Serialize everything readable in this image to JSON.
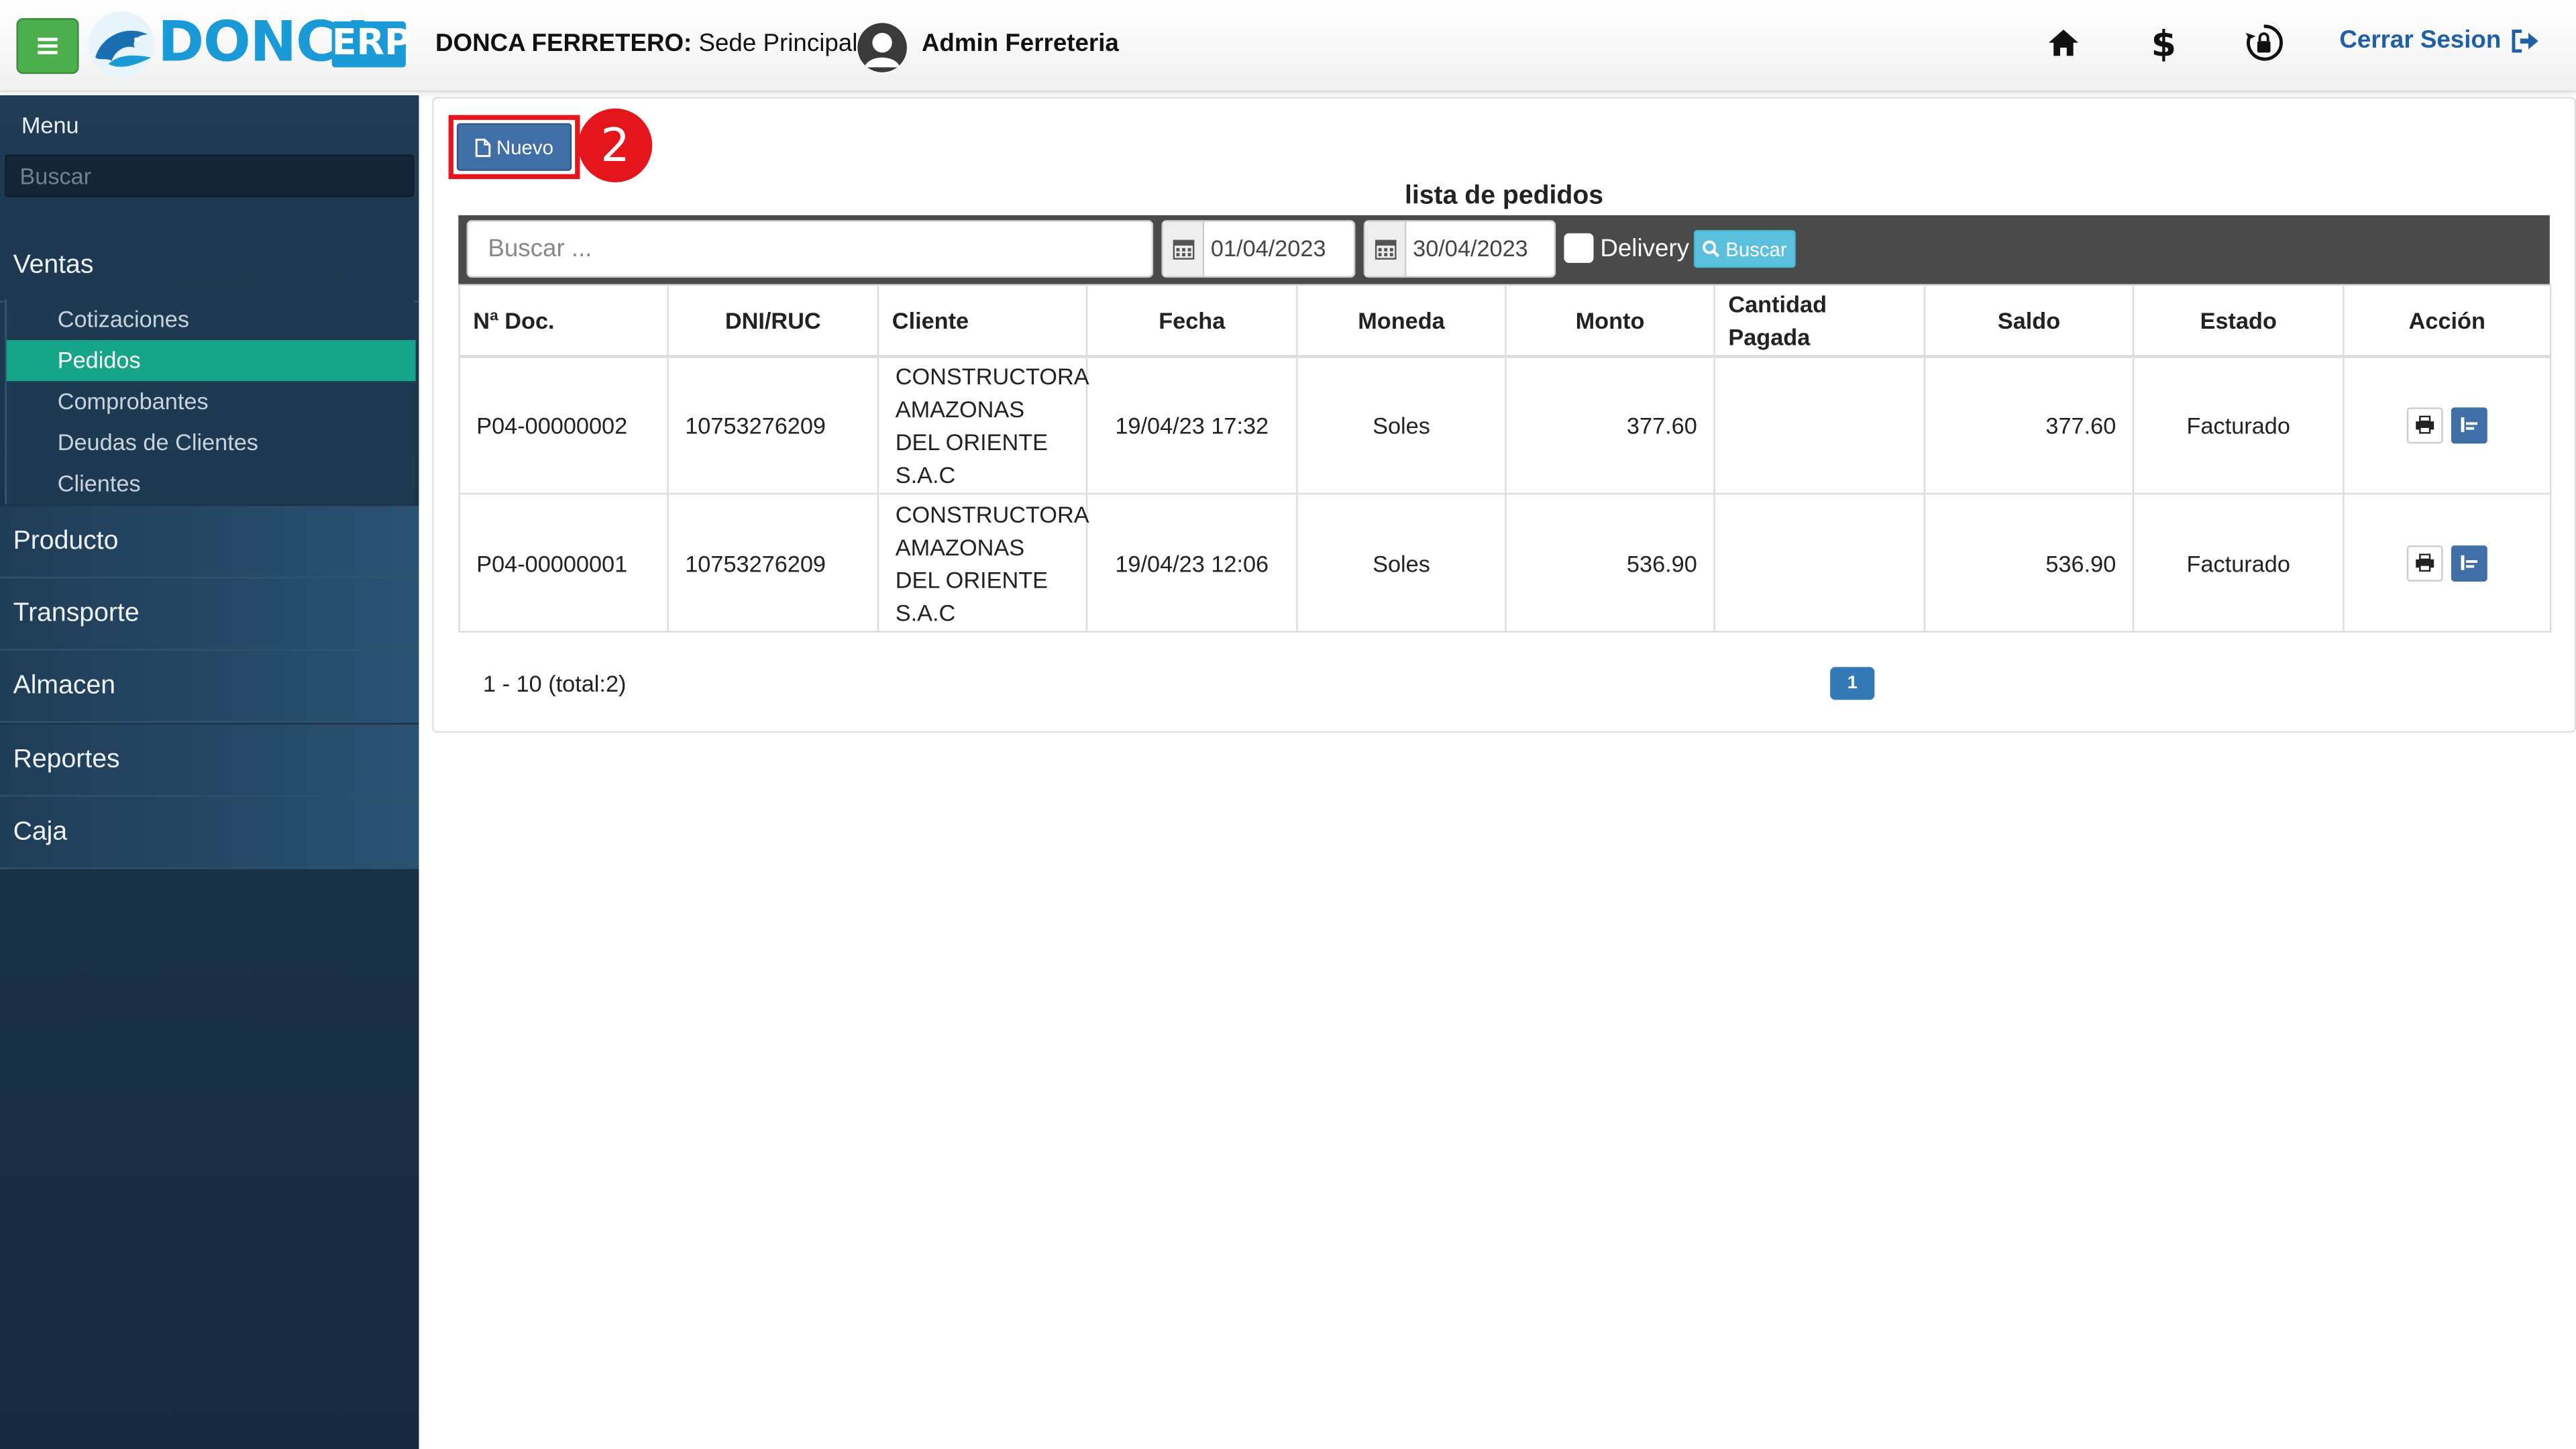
{
  "header": {
    "logo_text": "DONCA",
    "logo_badge": "ERP",
    "company_name": "DONCA FERRETERO:",
    "branch": " Sede Principal | ",
    "user_name": "Admin Ferreteria",
    "logout_label": "Cerrar Sesion",
    "icons": [
      "menu-icon",
      "home-icon",
      "dollar-icon",
      "lock-refresh-icon",
      "logout-icon"
    ]
  },
  "sidebar": {
    "title": "Menu",
    "search_placeholder": "Buscar",
    "sections": [
      {
        "label": "Ventas",
        "expanded": true,
        "items": [
          {
            "label": "Cotizaciones",
            "active": false
          },
          {
            "label": "Pedidos",
            "active": true
          },
          {
            "label": "Comprobantes",
            "active": false
          },
          {
            "label": "Deudas de Clientes",
            "active": false
          },
          {
            "label": "Clientes",
            "active": false
          }
        ]
      },
      {
        "label": "Producto"
      },
      {
        "label": "Transporte"
      },
      {
        "label": "Almacen"
      },
      {
        "label": "Reportes"
      },
      {
        "label": "Caja"
      }
    ]
  },
  "main": {
    "new_button_label": "Nuevo",
    "step_number": "2",
    "list_title": "lista de pedidos",
    "filters": {
      "search_placeholder": "Buscar ...",
      "date_from": "01/04/2023",
      "date_to": "30/04/2023",
      "delivery_label": "Delivery",
      "delivery_checked": false,
      "search_button_label": "Buscar"
    },
    "table": {
      "headers": [
        "Nª Doc.",
        "DNI/RUC",
        "Cliente",
        "Fecha",
        "Moneda",
        "Monto",
        "Cantidad Pagada",
        "Saldo",
        "Estado",
        "Acción"
      ],
      "rows": [
        {
          "doc": "P04-00000002",
          "dni": "10753276209",
          "cliente": "CONSTRUCTORA AMAZONAS DEL ORIENTE S.A.C",
          "fecha": "19/04/23 17:32",
          "moneda": "Soles",
          "monto": "377.60",
          "pagada": "",
          "saldo": "377.60",
          "estado": "Facturado"
        },
        {
          "doc": "P04-00000001",
          "dni": "10753276209",
          "cliente": "CONSTRUCTORA AMAZONAS DEL ORIENTE S.A.C",
          "fecha": "19/04/23 12:06",
          "moneda": "Soles",
          "monto": "536.90",
          "pagada": "",
          "saldo": "536.90",
          "estado": "Facturado"
        }
      ]
    },
    "pagination": {
      "info": "1 - 10 (total:2)",
      "current_page": "1"
    }
  },
  "colors": {
    "accent_green": "#4cae4c",
    "brand_blue": "#1a9ad6",
    "sidebar_bg": "#1a3248",
    "active_item": "#17a589",
    "highlight_red": "#e4151b",
    "primary_button": "#3f6fa6"
  }
}
